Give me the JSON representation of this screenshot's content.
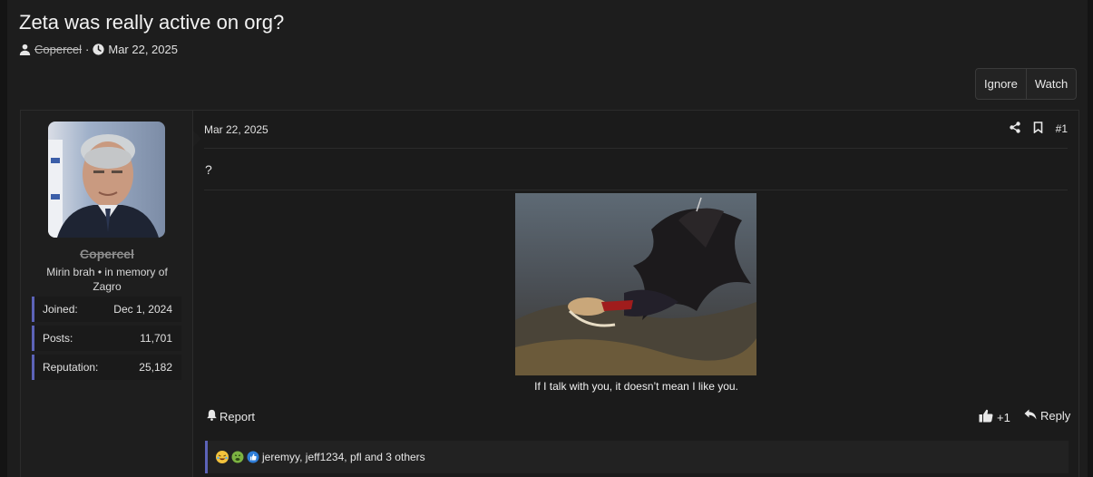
{
  "thread": {
    "title": "Zeta was really active on org?",
    "author": "Copercel",
    "separator": "·",
    "date": "Mar 22, 2025"
  },
  "thread_buttons": {
    "ignore": "Ignore",
    "watch": "Watch"
  },
  "user": {
    "name": "Copercel",
    "title": "Mirin brah • in memory of Zagro",
    "stats": [
      {
        "label": "Joined:",
        "value": "Dec 1, 2024"
      },
      {
        "label": "Posts:",
        "value": "11,701"
      },
      {
        "label": "Reputation:",
        "value": "25,182"
      }
    ]
  },
  "post": {
    "date": "Mar 22, 2025",
    "number": "#1",
    "body": "?",
    "caption": "If I talk with you, it doesn’t mean I like you.",
    "report_label": "Report",
    "react_label": "+1",
    "reply_label": "Reply",
    "reactions_text": "jeremyy, jeff1234, pfl and 3 others",
    "reaction_icons": [
      "laughing-crying-emoji",
      "sick-emoji",
      "thumbs-up-emoji"
    ]
  },
  "colors": {
    "accent": "#5c63b8",
    "background": "#1d1d1d"
  }
}
